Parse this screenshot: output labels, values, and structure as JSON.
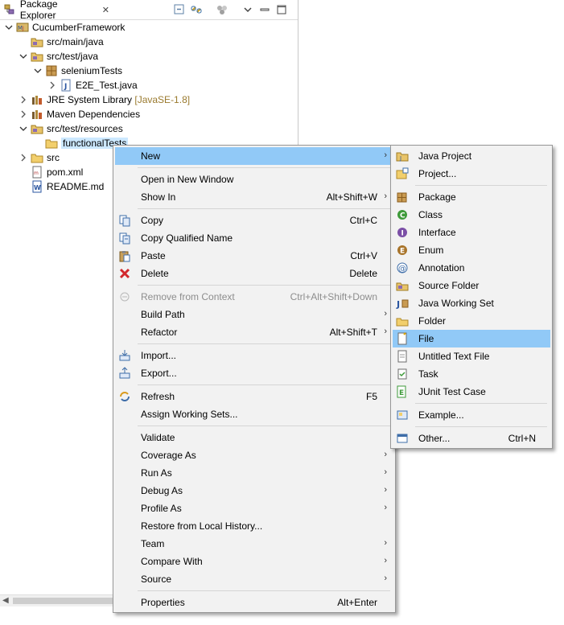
{
  "explorer": {
    "tab_title": "Package Explorer",
    "tab_close": "✕",
    "tree": [
      {
        "label": "CucumberFramework",
        "icon": "maven-project-icon",
        "depth": 0,
        "expanded": true
      },
      {
        "label": "src/main/java",
        "icon": "source-folder-icon",
        "depth": 1,
        "expanded": null
      },
      {
        "label": "src/test/java",
        "icon": "source-folder-icon",
        "depth": 1,
        "expanded": true
      },
      {
        "label": "seleniumTests",
        "icon": "package-icon",
        "depth": 2,
        "expanded": true
      },
      {
        "label": "E2E_Test.java",
        "icon": "java-file-icon",
        "depth": 3,
        "expanded": false
      },
      {
        "label": "JRE System Library",
        "decoration": "[JavaSE-1.8]",
        "icon": "library-icon",
        "depth": 1,
        "expanded": false
      },
      {
        "label": "Maven Dependencies",
        "icon": "library-icon",
        "depth": 1,
        "expanded": false
      },
      {
        "label": "src/test/resources",
        "icon": "source-folder-icon",
        "depth": 1,
        "expanded": true
      },
      {
        "label": "functionalTests",
        "icon": "folder-icon",
        "depth": 2,
        "expanded": null,
        "selected": true
      },
      {
        "label": "src",
        "icon": "folder-icon",
        "depth": 1,
        "expanded": false
      },
      {
        "label": "pom.xml",
        "icon": "xml-file-icon",
        "depth": 1,
        "expanded": null
      },
      {
        "label": "README.md",
        "icon": "text-file-icon",
        "depth": 1,
        "expanded": null
      }
    ]
  },
  "context_menu": {
    "items": [
      {
        "label": "New",
        "shortcut": "",
        "submenu": true,
        "highlight": true,
        "icon": ""
      },
      {
        "separator": true
      },
      {
        "label": "Open in New Window",
        "shortcut": "",
        "submenu": false,
        "icon": ""
      },
      {
        "label": "Show In",
        "shortcut": "Alt+Shift+W",
        "submenu": true,
        "icon": ""
      },
      {
        "separator": true
      },
      {
        "label": "Copy",
        "shortcut": "Ctrl+C",
        "submenu": false,
        "icon": "copy-icon"
      },
      {
        "label": "Copy Qualified Name",
        "shortcut": "",
        "submenu": false,
        "icon": "copy-qualified-icon"
      },
      {
        "label": "Paste",
        "shortcut": "Ctrl+V",
        "submenu": false,
        "icon": "paste-icon"
      },
      {
        "label": "Delete",
        "shortcut": "Delete",
        "submenu": false,
        "icon": "delete-icon"
      },
      {
        "separator": true
      },
      {
        "label": "Remove from Context",
        "shortcut": "Ctrl+Alt+Shift+Down",
        "submenu": false,
        "disabled": true,
        "icon": "remove-context-icon"
      },
      {
        "label": "Build Path",
        "shortcut": "",
        "submenu": true,
        "icon": ""
      },
      {
        "label": "Refactor",
        "shortcut": "Alt+Shift+T",
        "submenu": true,
        "icon": ""
      },
      {
        "separator": true
      },
      {
        "label": "Import...",
        "shortcut": "",
        "submenu": false,
        "icon": "import-icon"
      },
      {
        "label": "Export...",
        "shortcut": "",
        "submenu": false,
        "icon": "export-icon"
      },
      {
        "separator": true
      },
      {
        "label": "Refresh",
        "shortcut": "F5",
        "submenu": false,
        "icon": "refresh-icon"
      },
      {
        "label": "Assign Working Sets...",
        "shortcut": "",
        "submenu": false,
        "icon": ""
      },
      {
        "separator": true
      },
      {
        "label": "Validate",
        "shortcut": "",
        "submenu": false,
        "icon": ""
      },
      {
        "label": "Coverage As",
        "shortcut": "",
        "submenu": true,
        "icon": ""
      },
      {
        "label": "Run As",
        "shortcut": "",
        "submenu": true,
        "icon": ""
      },
      {
        "label": "Debug As",
        "shortcut": "",
        "submenu": true,
        "icon": ""
      },
      {
        "label": "Profile As",
        "shortcut": "",
        "submenu": true,
        "icon": ""
      },
      {
        "label": "Restore from Local History...",
        "shortcut": "",
        "submenu": false,
        "icon": ""
      },
      {
        "label": "Team",
        "shortcut": "",
        "submenu": true,
        "icon": ""
      },
      {
        "label": "Compare With",
        "shortcut": "",
        "submenu": true,
        "icon": ""
      },
      {
        "label": "Source",
        "shortcut": "",
        "submenu": true,
        "icon": ""
      },
      {
        "separator": true
      },
      {
        "label": "Properties",
        "shortcut": "Alt+Enter",
        "submenu": false,
        "icon": ""
      }
    ]
  },
  "new_submenu": {
    "items": [
      {
        "label": "Java Project",
        "shortcut": "",
        "icon": "java-project-icon"
      },
      {
        "label": "Project...",
        "shortcut": "",
        "icon": "project-icon"
      },
      {
        "separator": true
      },
      {
        "label": "Package",
        "shortcut": "",
        "icon": "new-package-icon"
      },
      {
        "label": "Class",
        "shortcut": "",
        "icon": "class-icon"
      },
      {
        "label": "Interface",
        "shortcut": "",
        "icon": "interface-icon"
      },
      {
        "label": "Enum",
        "shortcut": "",
        "icon": "enum-icon"
      },
      {
        "label": "Annotation",
        "shortcut": "",
        "icon": "annotation-icon"
      },
      {
        "label": "Source Folder",
        "shortcut": "",
        "icon": "new-source-folder-icon"
      },
      {
        "label": "Java Working Set",
        "shortcut": "",
        "icon": "working-set-icon"
      },
      {
        "label": "Folder",
        "shortcut": "",
        "icon": "new-folder-icon"
      },
      {
        "label": "File",
        "shortcut": "",
        "icon": "new-file-icon",
        "highlight": true
      },
      {
        "label": "Untitled Text File",
        "shortcut": "",
        "icon": "untitled-text-file-icon"
      },
      {
        "label": "Task",
        "shortcut": "",
        "icon": "task-icon"
      },
      {
        "label": "JUnit Test Case",
        "shortcut": "",
        "icon": "junit-icon"
      },
      {
        "separator": true
      },
      {
        "label": "Example...",
        "shortcut": "",
        "icon": "example-icon"
      },
      {
        "separator": true
      },
      {
        "label": "Other...",
        "shortcut": "Ctrl+N",
        "icon": "other-icon"
      }
    ]
  },
  "colors": {
    "menu_bg": "#f2f2f2",
    "menu_highlight": "#91c9f7",
    "selection": "#cce8ff",
    "disabled_text": "#8d8d8d",
    "decoration_text": "#9a7a2e"
  }
}
